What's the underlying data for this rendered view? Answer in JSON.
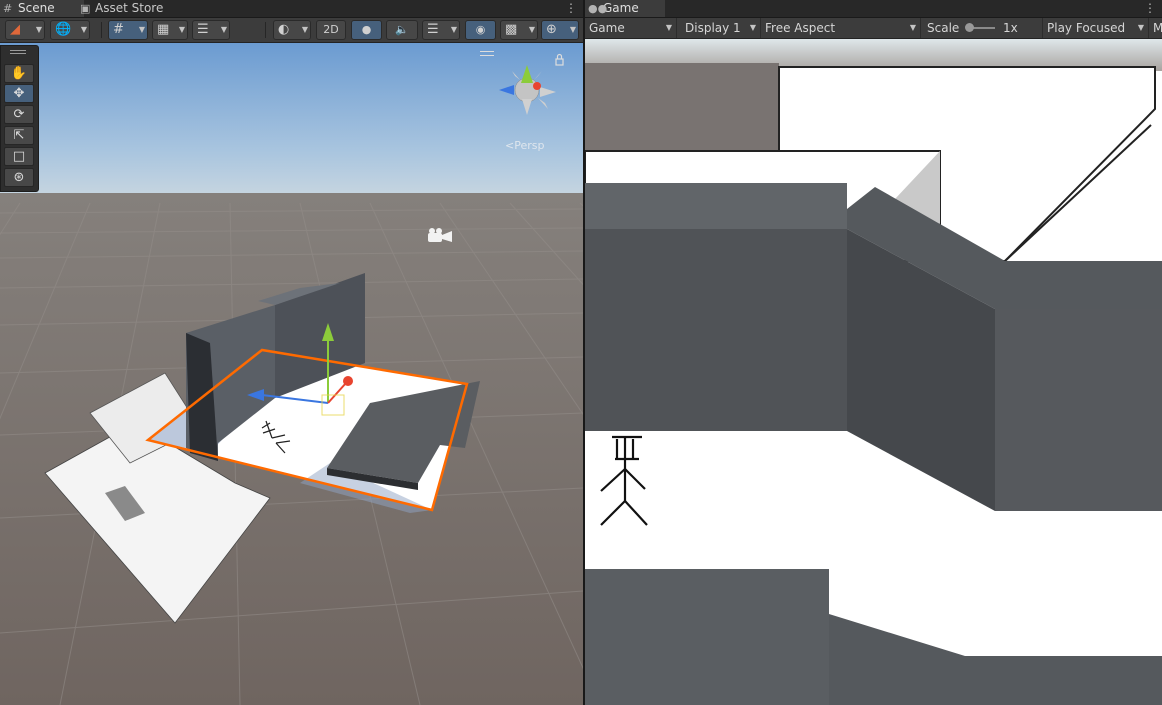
{
  "scene_panel": {
    "tabs": [
      {
        "label": "Scene",
        "icon": "grid-hash-icon"
      },
      {
        "label": "Asset Store",
        "icon": "shopping-bag-icon"
      }
    ],
    "toolbar": {
      "mode_2d": "2D"
    },
    "view_label": "Persp",
    "tools": [
      "hand-tool",
      "move-tool",
      "rotate-tool",
      "scale-tool",
      "rect-tool",
      "transform-tool"
    ],
    "selected_tool": "move-tool"
  },
  "game_panel": {
    "tab": {
      "label": "Game",
      "icon": "gamepad-icon"
    },
    "toolbar": {
      "view_select": "Game",
      "display_select": "Display 1",
      "aspect_select": "Free Aspect",
      "scale_label": "Scale",
      "scale_value": "1x",
      "play_mode_select": "Play Focused",
      "overflow_label": "M"
    }
  },
  "colors": {
    "selection_outline": "#ff6a00",
    "gizmo_x": "#e8442f",
    "gizmo_y": "#8ccc3a",
    "gizmo_z": "#3a76e0",
    "toggle_active": "#46607c"
  }
}
